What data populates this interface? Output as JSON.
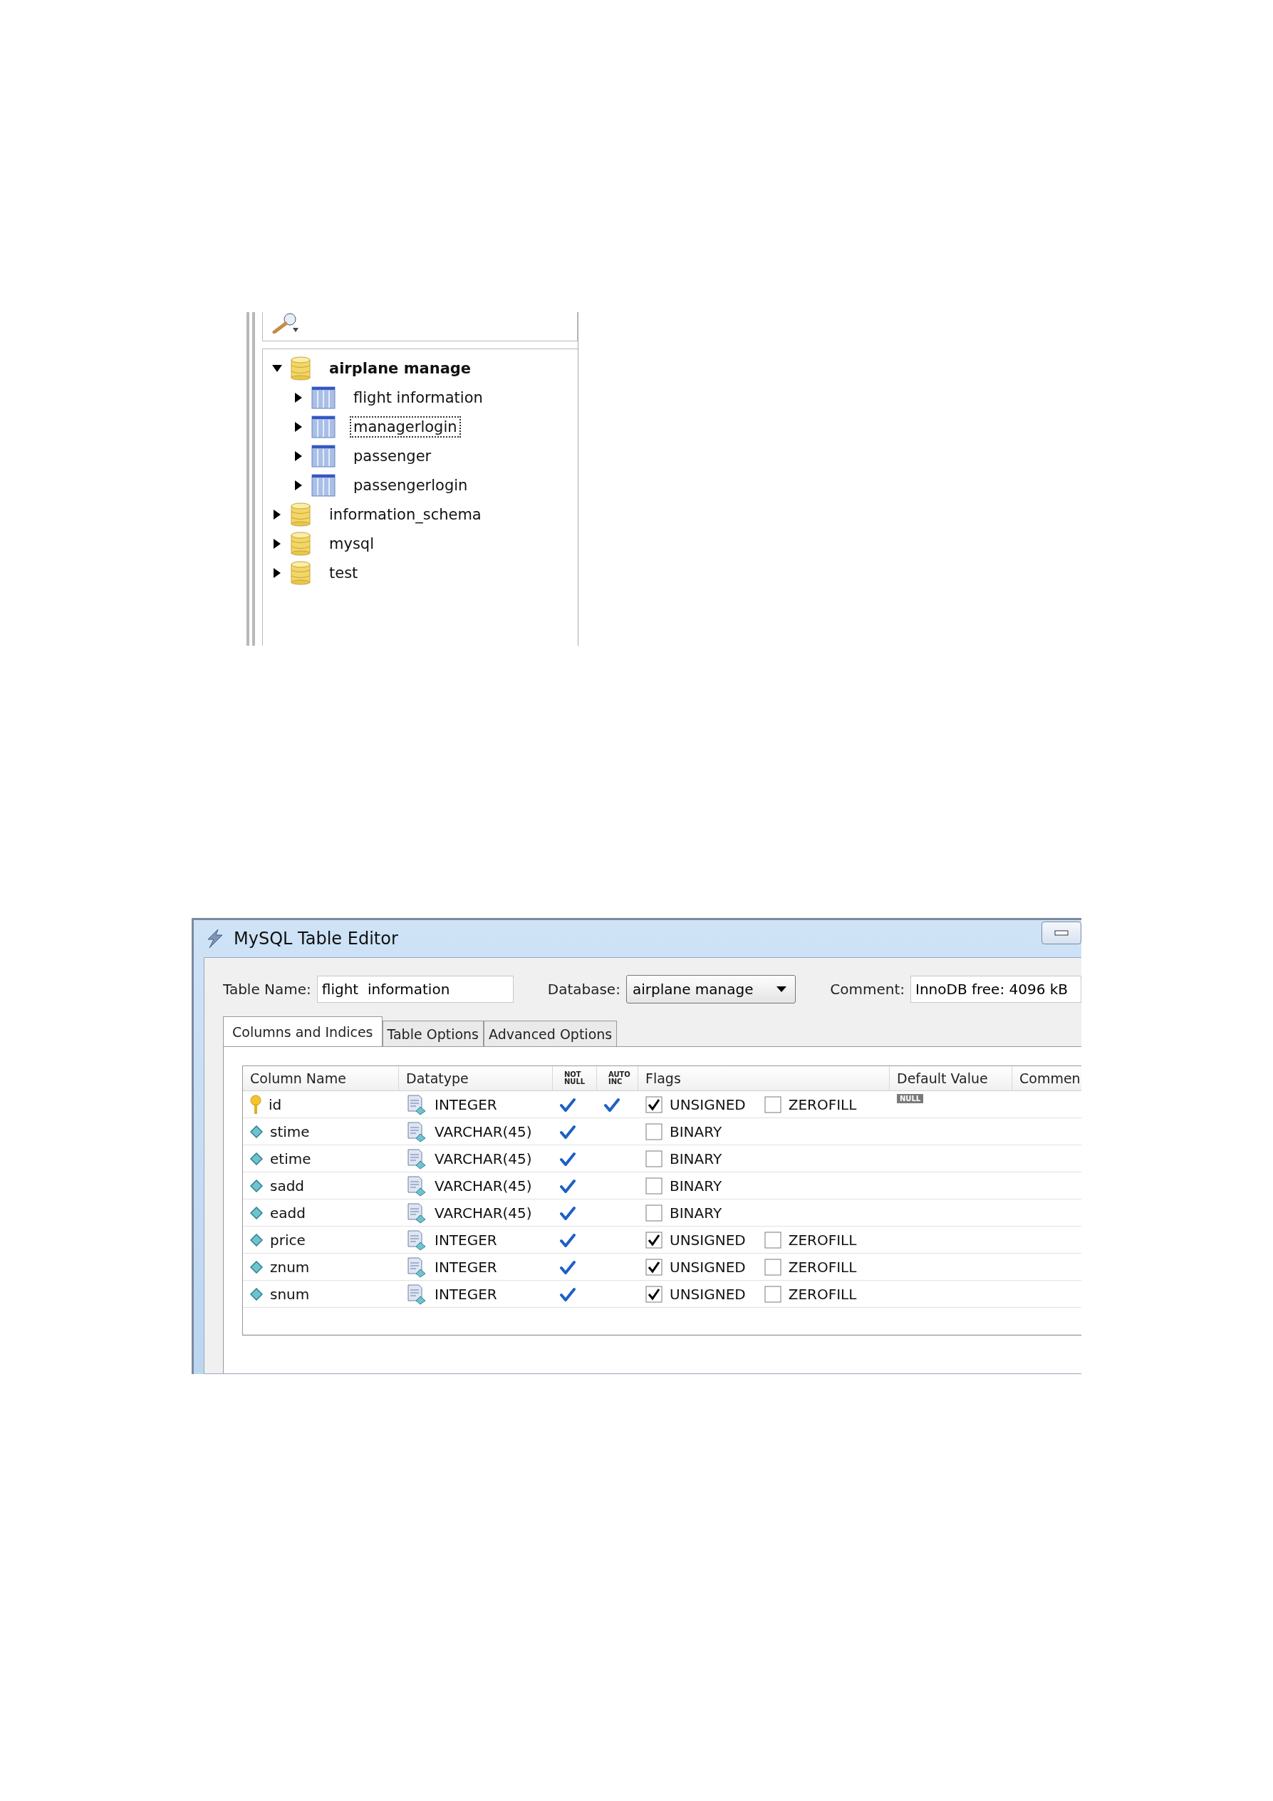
{
  "navigator": {
    "tree": [
      {
        "label": "airplane manage",
        "kind": "database",
        "expanded": true,
        "selected": false,
        "bold": true,
        "children": [
          {
            "label": "flight  information",
            "kind": "table",
            "expanded": false,
            "selected": false,
            "bold": false
          },
          {
            "label": "managerlogin",
            "kind": "table",
            "expanded": false,
            "selected": true,
            "bold": false
          },
          {
            "label": "passenger",
            "kind": "table",
            "expanded": false,
            "selected": false,
            "bold": false
          },
          {
            "label": "passengerlogin",
            "kind": "table",
            "expanded": false,
            "selected": false,
            "bold": false
          }
        ]
      },
      {
        "label": "information_schema",
        "kind": "database",
        "expanded": false,
        "selected": false,
        "bold": false
      },
      {
        "label": "mysql",
        "kind": "database",
        "expanded": false,
        "selected": false,
        "bold": false
      },
      {
        "label": "test",
        "kind": "database",
        "expanded": false,
        "selected": false,
        "bold": false
      }
    ]
  },
  "window": {
    "title": "MySQL Table Editor"
  },
  "form": {
    "table_name_label": "Table Name:",
    "table_name": "flight  information",
    "database_label": "Database:",
    "database": "airplane manage",
    "comment_label": "Comment:",
    "comment": "InnoDB free: 4096 kB"
  },
  "tabs": [
    {
      "label": "Columns and Indices",
      "selected": true
    },
    {
      "label": "Table Options",
      "selected": false
    },
    {
      "label": "Advanced Options",
      "selected": false
    }
  ],
  "table": {
    "columns": [
      "Column Name",
      "Datatype",
      "NOT NULL",
      "AUTO INC",
      "Flags",
      "Default Value",
      "Commen"
    ],
    "rows": [
      {
        "name": "id",
        "kind": "primary",
        "datatype": "INTEGER",
        "not_null": true,
        "auto_inc": true,
        "flags": [
          {
            "label": "UNSIGNED",
            "checked": true
          },
          {
            "label": "ZEROFILL",
            "checked": false
          }
        ],
        "default_value": "NULL"
      },
      {
        "name": "stime",
        "kind": "column",
        "datatype": "VARCHAR(45)",
        "not_null": true,
        "auto_inc": false,
        "flags": [
          {
            "label": "BINARY",
            "checked": false
          }
        ]
      },
      {
        "name": "etime",
        "kind": "column",
        "datatype": "VARCHAR(45)",
        "not_null": true,
        "auto_inc": false,
        "flags": [
          {
            "label": "BINARY",
            "checked": false
          }
        ]
      },
      {
        "name": "sadd",
        "kind": "column",
        "datatype": "VARCHAR(45)",
        "not_null": true,
        "auto_inc": false,
        "flags": [
          {
            "label": "BINARY",
            "checked": false
          }
        ]
      },
      {
        "name": "eadd",
        "kind": "column",
        "datatype": "VARCHAR(45)",
        "not_null": true,
        "auto_inc": false,
        "flags": [
          {
            "label": "BINARY",
            "checked": false
          }
        ]
      },
      {
        "name": "price",
        "kind": "column",
        "datatype": "INTEGER",
        "not_null": true,
        "auto_inc": false,
        "flags": [
          {
            "label": "UNSIGNED",
            "checked": true
          },
          {
            "label": "ZEROFILL",
            "checked": false
          }
        ]
      },
      {
        "name": "znum",
        "kind": "column",
        "datatype": "INTEGER",
        "not_null": true,
        "auto_inc": false,
        "flags": [
          {
            "label": "UNSIGNED",
            "checked": true
          },
          {
            "label": "ZEROFILL",
            "checked": false
          }
        ]
      },
      {
        "name": "snum",
        "kind": "column",
        "datatype": "INTEGER",
        "not_null": true,
        "auto_inc": false,
        "flags": [
          {
            "label": "UNSIGNED",
            "checked": true
          },
          {
            "label": "ZEROFILL",
            "checked": false
          }
        ]
      }
    ]
  }
}
